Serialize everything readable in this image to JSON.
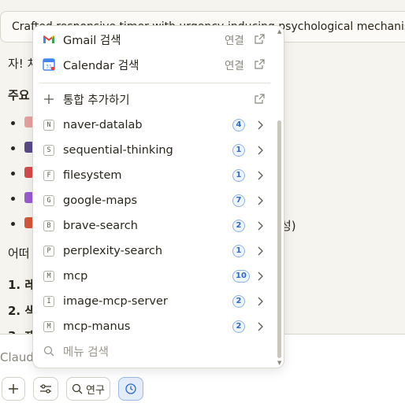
{
  "chat": {
    "artifact_title": "Crafted responsive timer with urgency-inducing psychological mechanisms",
    "line1": "자! 차",
    "heading": "주요",
    "bullet_tail": "성)",
    "followup": "어떠",
    "numbered": [
      "1. 레",
      "2. 색",
      "3. 재"
    ]
  },
  "menu": {
    "apps": [
      {
        "label": "Gmail 검색",
        "action": "연결",
        "icon": "gmail-icon"
      },
      {
        "label": "Calendar 검색",
        "action": "연결",
        "icon": "calendar-icon",
        "icon_text": "31"
      }
    ],
    "add_integration": "통합 추가하기",
    "servers": [
      {
        "badge": "N",
        "label": "naver-datalab",
        "count": "4"
      },
      {
        "badge": "S",
        "label": "sequential-thinking",
        "count": "1"
      },
      {
        "badge": "F",
        "label": "filesystem",
        "count": "1"
      },
      {
        "badge": "G",
        "label": "google-maps",
        "count": "7"
      },
      {
        "badge": "B",
        "label": "brave-search",
        "count": "2"
      },
      {
        "badge": "P",
        "label": "perplexity-search",
        "count": "1"
      },
      {
        "badge": "M",
        "label": "mcp",
        "count": "10"
      },
      {
        "badge": "I",
        "label": "image-mcp-server",
        "count": "2"
      },
      {
        "badge": "M",
        "label": "mcp-manus",
        "count": "2"
      }
    ],
    "search_placeholder": "메뉴 검색"
  },
  "composer": {
    "placeholder": "Claud",
    "research_label": "연구"
  },
  "colors": {
    "accent_blue": "#2e6ac4",
    "badge_border": "#8fb3e6",
    "background": "#f5f4ef"
  }
}
